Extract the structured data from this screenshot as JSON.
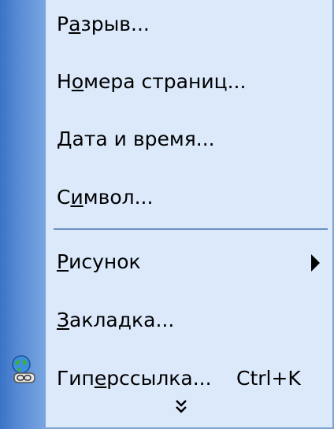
{
  "menu": {
    "items": [
      {
        "pre": "Р",
        "ul": "а",
        "post": "зрыв..."
      },
      {
        "pre": "Н",
        "ul": "о",
        "post": "мера страниц..."
      },
      {
        "pre": "",
        "ul": "Д",
        "post": "ата и время..."
      },
      {
        "pre": "С",
        "ul": "и",
        "post": "мвол..."
      },
      {
        "pre": "",
        "ul": "Р",
        "post": "исунок"
      },
      {
        "pre": "",
        "ul": "З",
        "post": "акладка..."
      },
      {
        "pre": "Гип",
        "ul": "е",
        "post": "рссылка...",
        "shortcut": "Ctrl+K"
      }
    ]
  },
  "colors": {
    "menu_bg": "#dbe9fb",
    "gutter": "#5a8dd6",
    "separator": "#6c8fc0"
  },
  "icons": {
    "submenu": "chevron-right-icon",
    "hyperlink": "hyperlink-globe-icon",
    "expand": "double-chevron-down-icon"
  }
}
